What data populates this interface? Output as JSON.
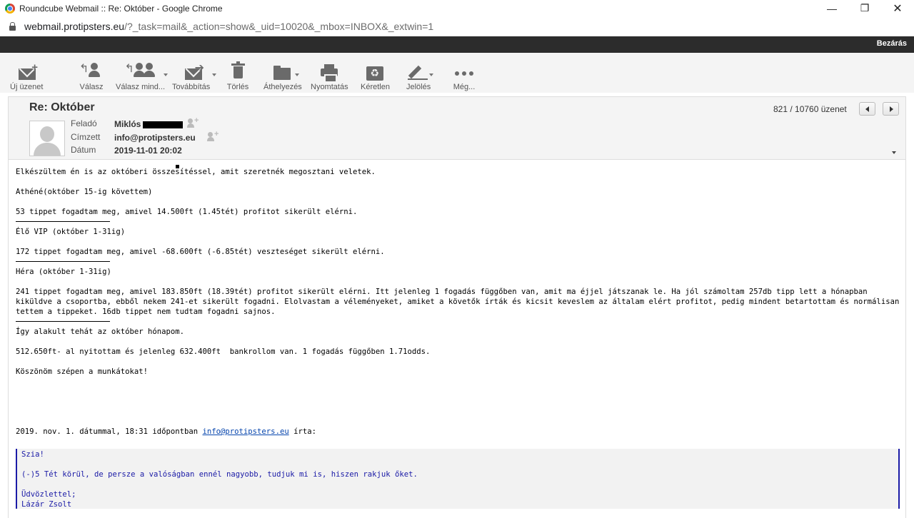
{
  "window": {
    "title": "Roundcube Webmail :: Re: Október - Google Chrome",
    "controls": {
      "minimize": "—",
      "maximize": "❐",
      "close": "✕"
    }
  },
  "address_bar": {
    "host": "webmail.protipsters.eu",
    "path": "/?_task=mail&_action=show&_uid=10020&_mbox=INBOX&_extwin=1"
  },
  "topbar": {
    "close_label": "Bezárás"
  },
  "toolbar": {
    "compose": "Új üzenet",
    "reply": "Válasz",
    "reply_all": "Válasz mind...",
    "forward": "Továbbítás",
    "delete": "Törlés",
    "move": "Áthelyezés",
    "print": "Nyomtatás",
    "archive": "Kéretlen",
    "mark": "Jelölés",
    "more": "Még..."
  },
  "message": {
    "subject": "Re: Október",
    "from_label": "Feladó",
    "from_value": "Miklós",
    "to_label": "Címzett",
    "to_value": "info@protipsters.eu",
    "date_label": "Dátum",
    "date_value": "2019-11-01 20:02",
    "counter": "821 / 10760 üzenet"
  },
  "body": {
    "p1": "Elkészültem én is az októberi összesítéssel, amit szeretnék megosztani veletek.",
    "p2": "Athéné(október 15-ig követtem)",
    "p3": "53 tippet fogadtam meg, amivel 14.500ft (1.45tét) profitot sikerült elérni.",
    "p4": "Élő VIP (október 1-31ig)",
    "p5": "172 tippet fogadtam meg, amivel -68.600ft (-6.85tét) veszteséget sikerült elérni.",
    "p6": "Héra (október 1-31ig)",
    "p7": "241 tippet fogadtam meg, amivel 183.850ft (18.39tét) profitot sikerült elérni. Itt jelenleg 1 fogadás függőben van, amit ma éjjel játszanak le. Ha jól számoltam 257db tipp lett a hónapban kiküldve a csoportba, ebből nekem 241-et sikerült fogadni. Elolvastam a véleményeket, amiket a követők írták és kicsit keveslem az általam elért profitot, pedig mindent betartottam és normálisan tettem a tippeket. 16db tippet nem tudtam fogadni sajnos.",
    "p8": "Így alakult tehát az október hónapom.",
    "p9": "512.650ft- al nyitottam és jelenleg 632.400ft  bankrollom van. 1 fogadás függőben 1.71odds.",
    "p10": "Köszönöm szépen a munkátokat!",
    "reply_intro_prefix": "2019. nov. 1. dátummal, 18:31 időpontban",
    "reply_intro_link": "info@protipsters.eu",
    "reply_intro_suffix": "írta:"
  },
  "quote": {
    "l1": "Szia!",
    "l2": "(-)5 Tét körül, de persze a valóságban ennél nagyobb, tudjuk mi is, hiszen rakjuk őket.",
    "l3": "Üdvözlettel;",
    "l4": "Lázár Zsolt"
  }
}
